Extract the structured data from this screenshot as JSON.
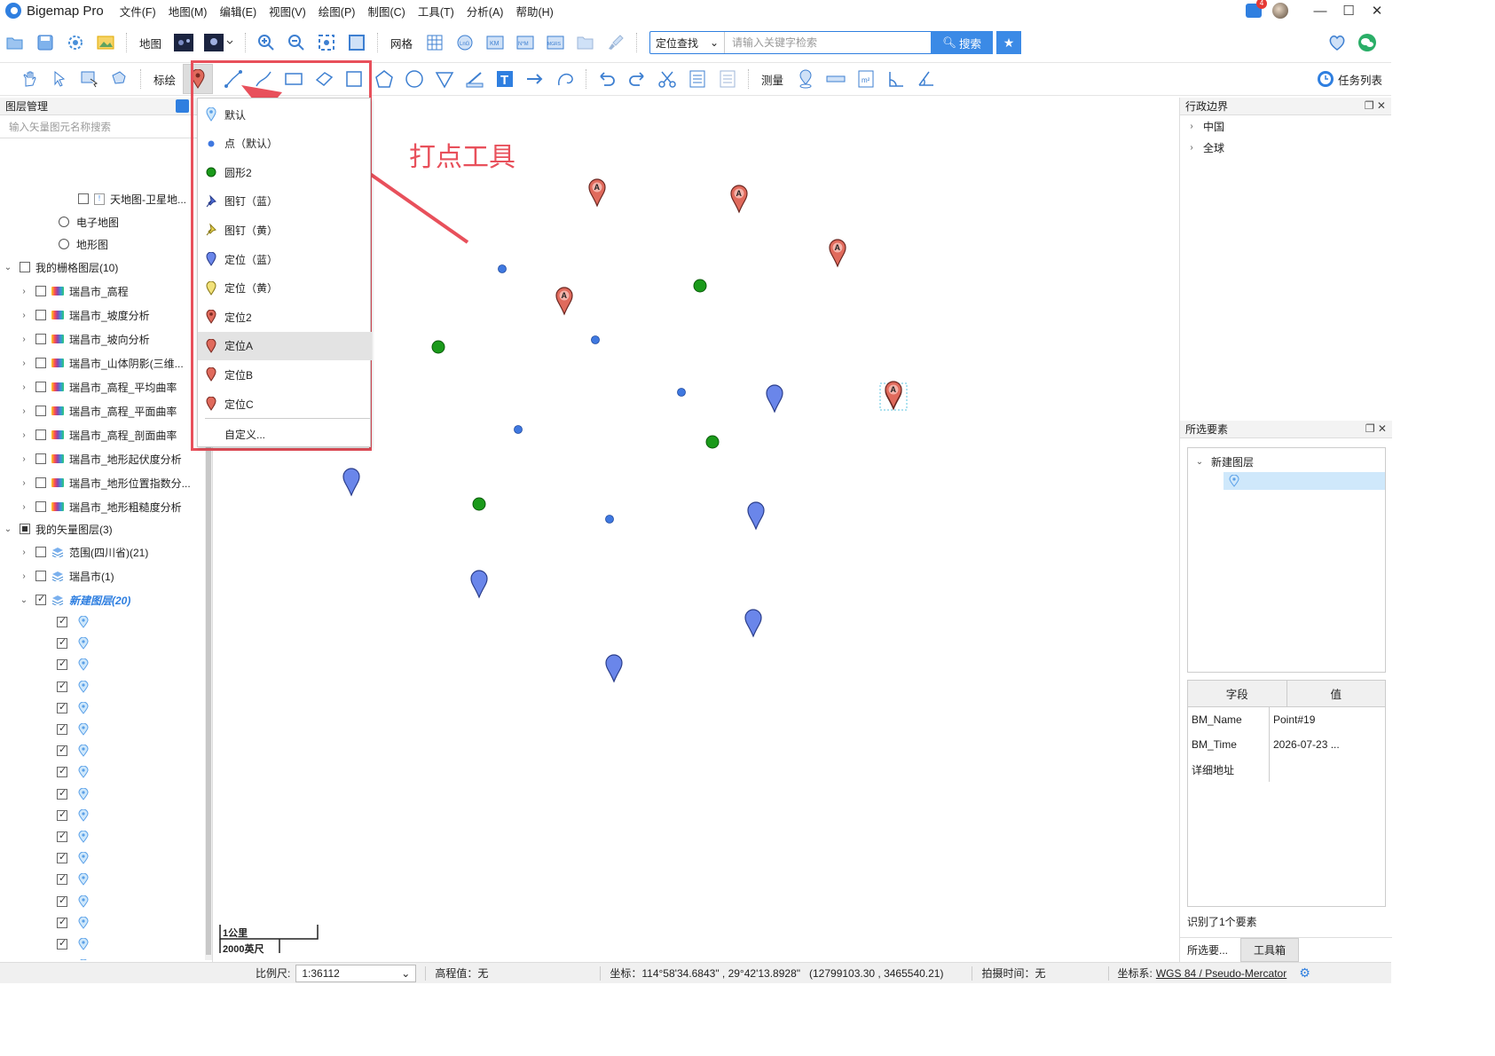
{
  "app": {
    "title": "Bigemap Pro",
    "notification_count": "4"
  },
  "menu": [
    "文件(F)",
    "地图(M)",
    "编辑(E)",
    "视图(V)",
    "绘图(P)",
    "制图(C)",
    "工具(T)",
    "分析(A)",
    "帮助(H)"
  ],
  "toolbar1": {
    "map_label": "地图",
    "grid_label": "网格",
    "search_mode": "定位查找",
    "search_placeholder": "请输入关键字检索",
    "search_button": "搜索"
  },
  "toolbar2": {
    "mark_label": "标绘",
    "measure_label": "测量",
    "task_list": "任务列表"
  },
  "layers_panel": {
    "title": "图层管理",
    "search_placeholder": "输入矢量图元名称搜索",
    "basemaps": [
      "天地图-卫星地...",
      "电子地图",
      "地形图"
    ],
    "raster_group": "我的栅格图层(10)",
    "raster_layers": [
      "瑞昌市_高程",
      "瑞昌市_坡度分析",
      "瑞昌市_坡向分析",
      "瑞昌市_山体阴影(三维...",
      "瑞昌市_高程_平均曲率",
      "瑞昌市_高程_平面曲率",
      "瑞昌市_高程_剖面曲率",
      "瑞昌市_地形起伏度分析",
      "瑞昌市_地形位置指数分...",
      "瑞昌市_地形粗糙度分析"
    ],
    "vector_group": "我的矢量图层(3)",
    "vector_layers": [
      "范围(四川省)(21)",
      "瑞昌市(1)",
      "新建图层(20)"
    ],
    "sub_item_count": 18
  },
  "point_dropdown": {
    "items": [
      "默认",
      "点（默认）",
      "圆形2",
      "图钉（蓝）",
      "图钉（黄）",
      "定位（蓝）",
      "定位（黄）",
      "定位2",
      "定位A",
      "定位B",
      "定位C"
    ],
    "custom": "自定义...",
    "highlighted": "定位A"
  },
  "annotation": "打点工具",
  "scalebar": {
    "top": "1公里",
    "bottom": "2000英尺"
  },
  "admin_panel": {
    "title": "行政边界",
    "items": [
      "中国",
      "全球"
    ]
  },
  "selection_panel": {
    "title": "所选要素",
    "layer": "新建图层",
    "table_headers": [
      "字段",
      "值"
    ],
    "rows": [
      {
        "field": "BM_Name",
        "value": "Point#19"
      },
      {
        "field": "BM_Time",
        "value": "2026-07-23 ..."
      },
      {
        "field": "详细地址",
        "value": ""
      }
    ],
    "recognized": "识别了1个要素",
    "tabs": [
      "所选要...",
      "工具箱"
    ]
  },
  "statusbar": {
    "scale_label": "比例尺:",
    "scale_value": "1:36112",
    "elevation": "高程值：无",
    "coords_label": "坐标：",
    "coords": "114°58'34.6843\" , 29°42'13.8928\"   (12799103.30 , 3465540.21)",
    "capture_time": "拍摄时间：无",
    "crs_label": "坐标系:",
    "crs": "WGS 84 / Pseudo-Mercator"
  },
  "colors": {
    "accent": "#2f7fe0",
    "annotation_red": "#e8505b",
    "pin_red": "#e06a5c",
    "pin_blue": "#6a86ea",
    "dot_green": "#1a9a1a",
    "dot_blue": "#3f78e0"
  },
  "map_features": {
    "red_pins": 6,
    "blue_pins": 7,
    "green_dots": 4,
    "blue_dots": 6
  }
}
